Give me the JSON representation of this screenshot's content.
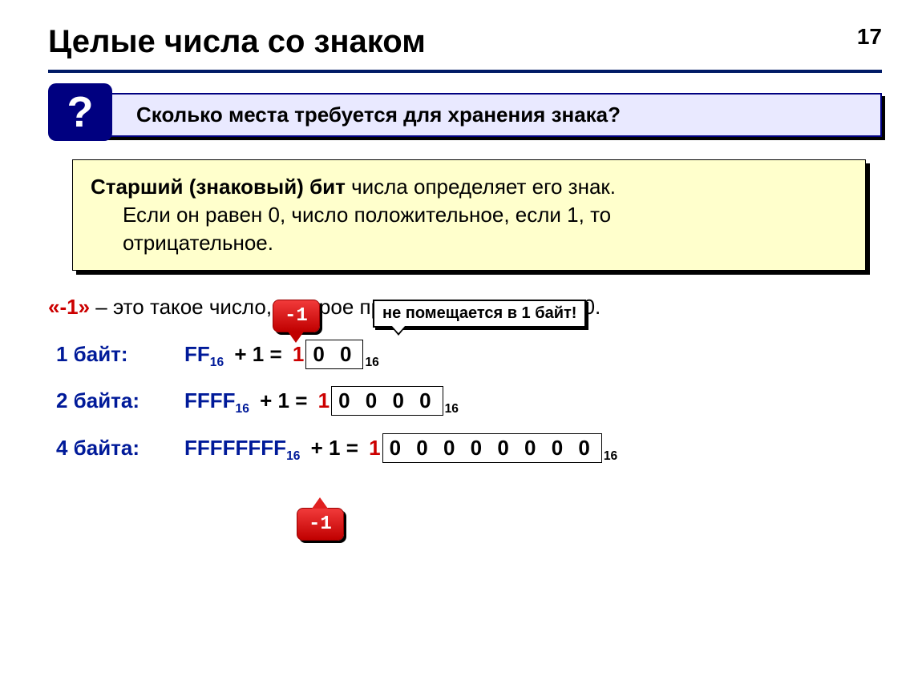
{
  "page_number": "17",
  "title": "Целые числа со знаком",
  "question_mark": "?",
  "question_text": "Сколько места требуется для хранения знака?",
  "definition": {
    "bold_start": "Старший (знаковый) бит",
    "rest1": " числа определяет его знак.",
    "line2": "Если он равен 0, число положительное, если 1, то",
    "line3": "отрицательное."
  },
  "minus1_line": {
    "quoted": "«-1»",
    "rest": " – это такое число, которое при сложении с 1 даст 0."
  },
  "callouts": {
    "top_red": "-1",
    "white": "не помещается в 1 байт!",
    "bottom_red": "-1"
  },
  "rows": [
    {
      "label": "1 байт:",
      "hex": "FF",
      "hex_sub": "16",
      "plus": " + 1 = ",
      "leading_one": "1",
      "zeros": "0 0",
      "result_sub": "16"
    },
    {
      "label": "2 байта:",
      "hex": "FFFF",
      "hex_sub": "16",
      "plus": " + 1 = ",
      "leading_one": "1",
      "zeros": "0 0 0 0",
      "result_sub": "16"
    },
    {
      "label": "4 байта:",
      "hex": "FFFFFFFF",
      "hex_sub": "16",
      "plus": " + 1 = ",
      "leading_one": "1",
      "zeros": "0 0 0 0 0 0 0 0",
      "result_sub": "16"
    }
  ]
}
